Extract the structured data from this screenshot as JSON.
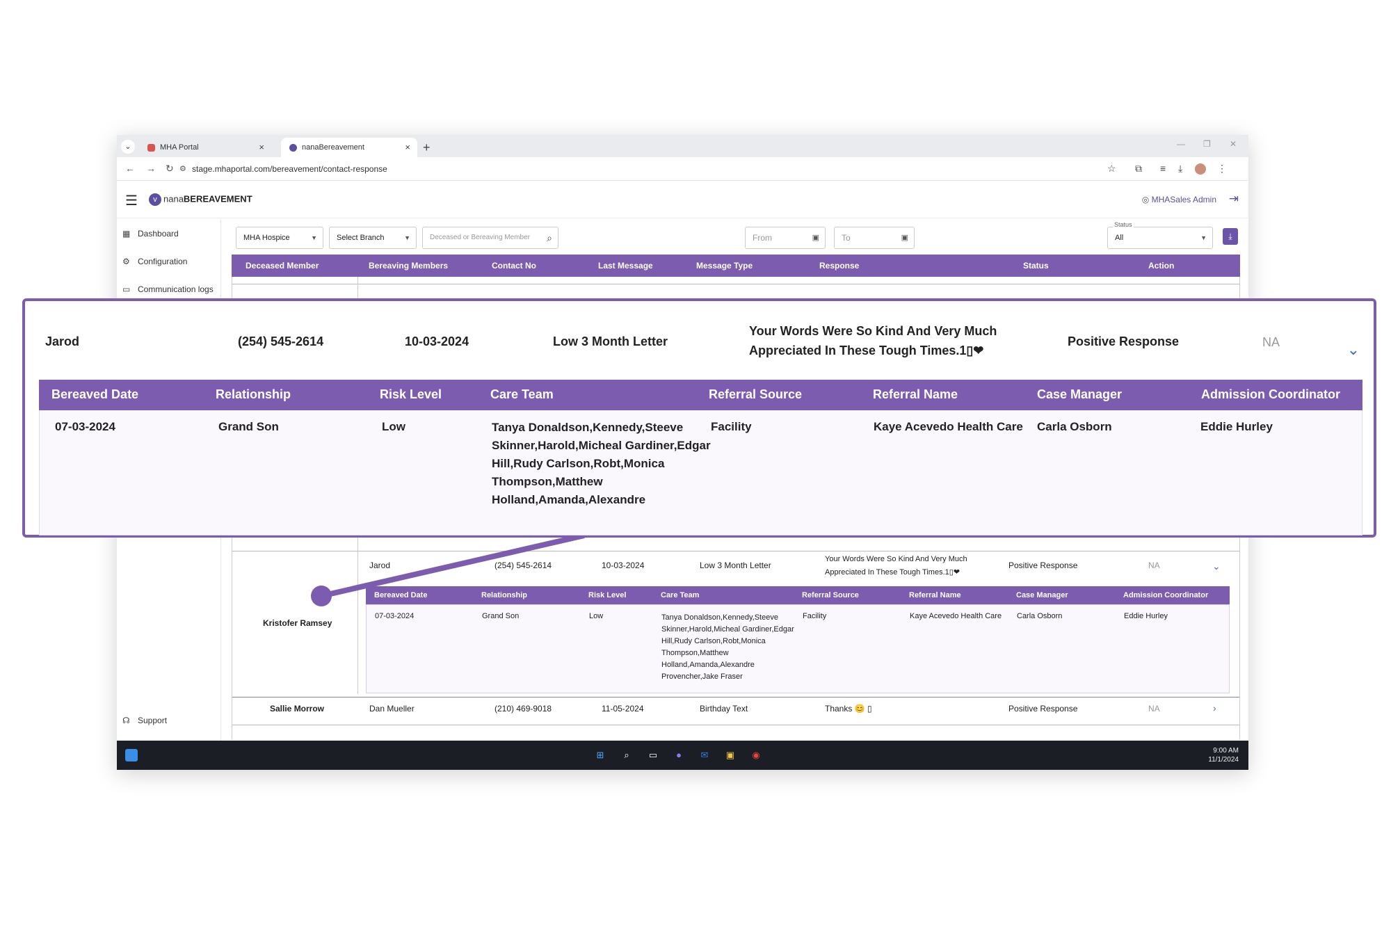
{
  "browser": {
    "tabs": [
      {
        "title": "MHA Portal"
      },
      {
        "title": "nanaBereavement"
      }
    ],
    "url": "stage.mhaportal.com/bereavement/contact-response"
  },
  "app": {
    "logo_prefix": "nana",
    "logo_bold": "BEREAVEMENT",
    "user_name": "MHASales Admin"
  },
  "sidebar": {
    "items": [
      {
        "label": "Dashboard",
        "icon": "dashboard-icon"
      },
      {
        "label": "Configuration",
        "icon": "gear-icon"
      },
      {
        "label": "Communication logs",
        "icon": "chat-icon"
      }
    ],
    "support_label": "Support"
  },
  "filters": {
    "hospice": "MHA Hospice",
    "branch": "Select Branch",
    "search_placeholder": "Deceased or Bereaving Member",
    "from_placeholder": "From",
    "to_placeholder": "To",
    "status_label": "Status",
    "status_value": "All"
  },
  "table": {
    "columns": [
      "Deceased Member",
      "Bereaving Members",
      "Contact No",
      "Last Message",
      "Message Type",
      "Response",
      "Status",
      "Action"
    ],
    "rows": [
      {
        "deceased": "Kristofer Ramsey",
        "bereaving": "Jarod",
        "contact": "(254) 545-2614",
        "last_message": "10-03-2024",
        "message_type": "Low 3 Month Letter",
        "response_line1": "Your Words Were So Kind And Very Much",
        "response_line2": "Appreciated In These Tough Times.1▯❤",
        "status": "Positive Response",
        "action": "NA"
      },
      {
        "deceased": "Sallie Morrow",
        "bereaving": "Dan Mueller",
        "contact": "(210) 469-9018",
        "last_message": "11-05-2024",
        "message_type": "Birthday Text",
        "response_line1": "Thanks 😊 ▯",
        "status": "Positive Response",
        "action": "NA"
      }
    ]
  },
  "detail": {
    "columns": [
      "Bereaved Date",
      "Relationship",
      "Risk Level",
      "Care Team",
      "Referral Source",
      "Referral Name",
      "Case Manager",
      "Admission Coordinator"
    ],
    "bereaved_date": "07-03-2024",
    "relationship": "Grand Son",
    "risk_level": "Low",
    "care_team_lines": [
      "Tanya Donaldson,Kennedy,Steeve",
      "Skinner,Harold,Micheal Gardiner,Edgar",
      "Hill,Rudy Carlson,Robt,Monica",
      "Thompson,Matthew",
      "Holland,Amanda,Alexandre",
      "Provencher,Jake Fraser"
    ],
    "referral_source": "Facility",
    "referral_name": "Kaye Acevedo Health Care",
    "case_manager": "Carla Osborn",
    "admission_coordinator": "Eddie Hurley"
  },
  "taskbar": {
    "time": "9:00 AM",
    "date": "11/1/2024"
  },
  "colors": {
    "accent": "#7c5cae",
    "link": "#3a70c9"
  }
}
